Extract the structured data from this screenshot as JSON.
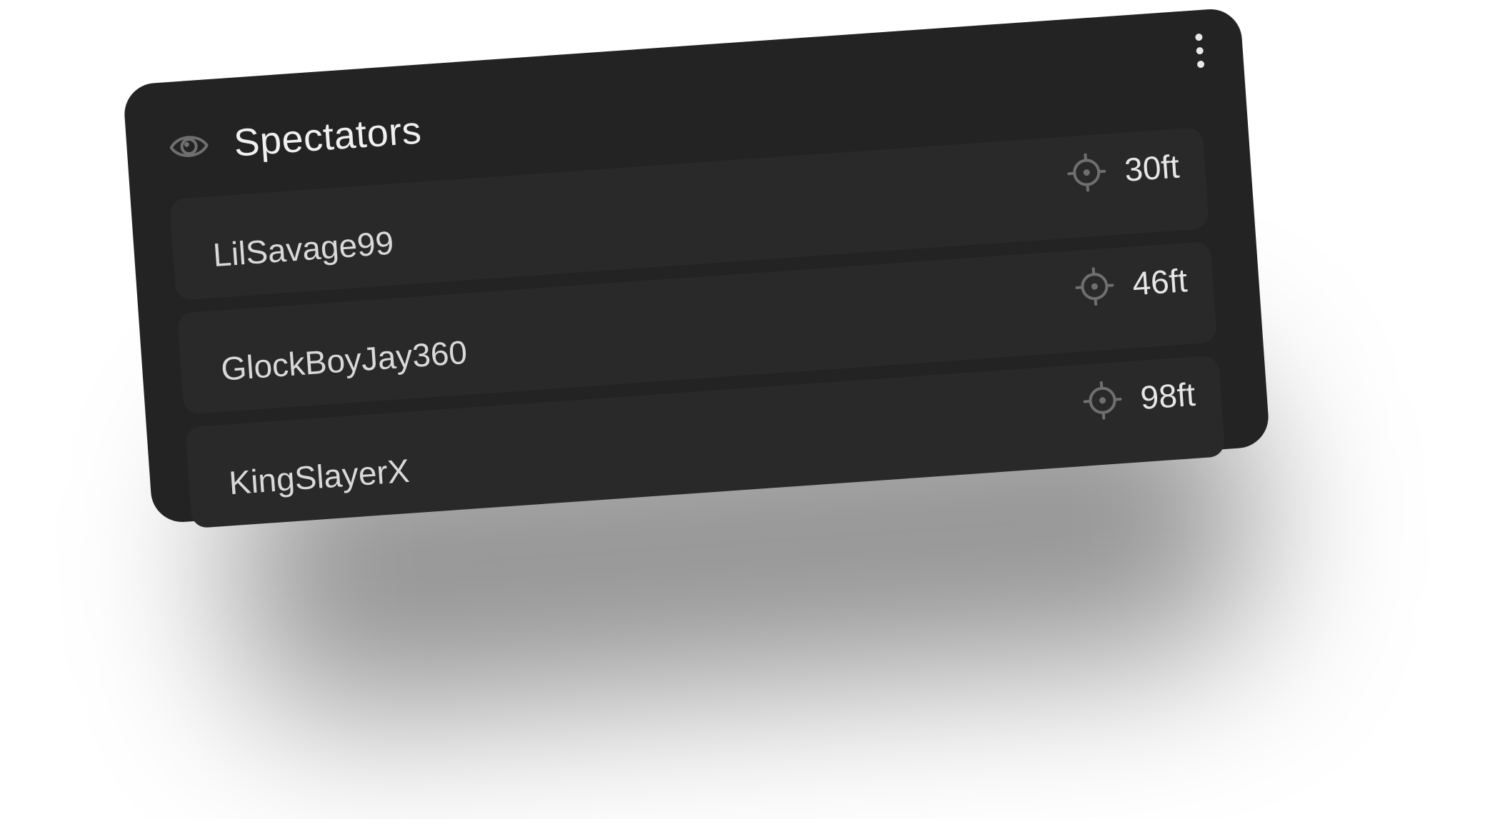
{
  "panel": {
    "title": "Spectators",
    "header_icon": "eye-icon",
    "menu_icon": "more-vertical-icon"
  },
  "spectators": [
    {
      "name": "LilSavage99",
      "distance": "30ft",
      "icon": "crosshair-icon"
    },
    {
      "name": "GlockBoyJay360",
      "distance": "46ft",
      "icon": "crosshair-icon"
    },
    {
      "name": "KingSlayerX",
      "distance": "98ft",
      "icon": "crosshair-icon"
    }
  ],
  "colors": {
    "panel_bg": "#242323",
    "row_bg": "#2a2929",
    "text_primary": "#f0f0f0",
    "icon_gray": "#6f6f6f"
  }
}
